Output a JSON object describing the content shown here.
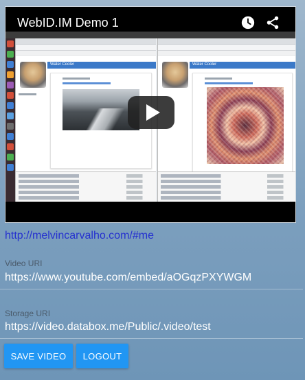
{
  "video": {
    "title": "WebID.IM Demo 1",
    "clock_icon": "clock-icon",
    "share_icon": "share-icon",
    "play_icon": "play-icon",
    "screencast": {
      "left_panel_title": "Water Cooler",
      "right_panel_title": "Water Cooler"
    }
  },
  "webid": {
    "link": "http://melvincarvalho.com/#me"
  },
  "fields": {
    "video_uri_label": "Video URI",
    "video_uri_value": "https://www.youtube.com/embed/aOGqzPXYWGM",
    "storage_uri_label": "Storage URI",
    "storage_uri_value": "https://video.databox.me/Public/.video/test"
  },
  "actions": {
    "save_label": "SAVE VIDEO",
    "logout_label": "LOGOUT"
  },
  "colors": {
    "accent": "#2196f3",
    "link": "#2531cf",
    "play_button": "#212121"
  }
}
